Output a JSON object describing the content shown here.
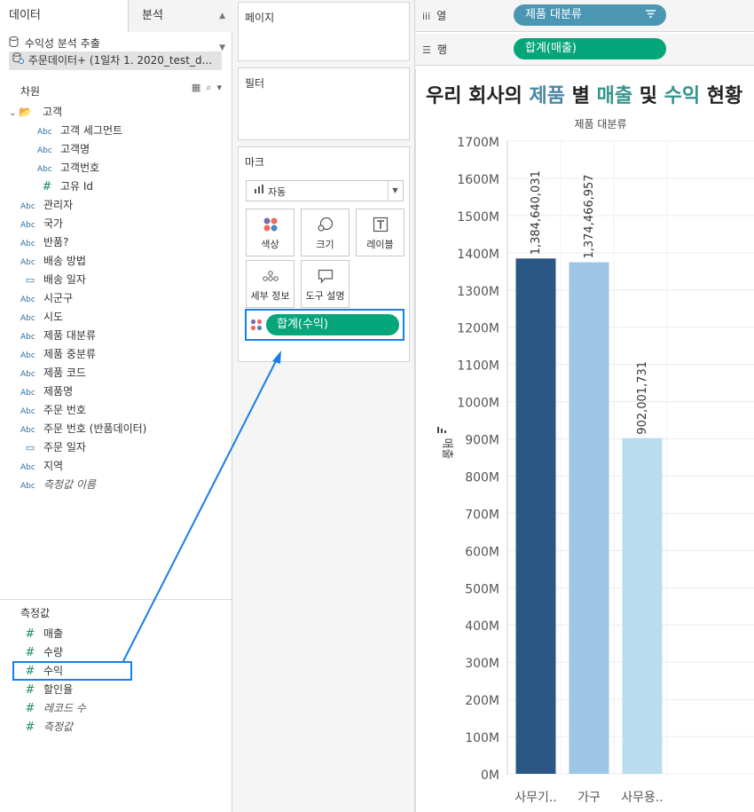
{
  "left": {
    "tabs": {
      "data": "데이터",
      "analysis": "분석"
    },
    "datasources": [
      "수익성 분석 추출",
      "주문데이터+ (1일차 1. 2020_test_d..."
    ],
    "dimensions_title": "차원",
    "dimension_fields": [
      {
        "label": "고객",
        "type": "folder",
        "indent": 0
      },
      {
        "label": "고객 세그먼트",
        "type": "abc",
        "indent": 1
      },
      {
        "label": "고객명",
        "type": "abc",
        "indent": 1
      },
      {
        "label": "고객번호",
        "type": "abc",
        "indent": 1
      },
      {
        "label": "고유 Id",
        "type": "num",
        "indent": 1
      },
      {
        "label": "관리자",
        "type": "abc",
        "indent": 0
      },
      {
        "label": "국가",
        "type": "abc",
        "indent": 0
      },
      {
        "label": "반품?",
        "type": "abc",
        "indent": 0
      },
      {
        "label": "배송 방법",
        "type": "abc",
        "indent": 0
      },
      {
        "label": "배송 일자",
        "type": "cal",
        "indent": 0
      },
      {
        "label": "시군구",
        "type": "abc",
        "indent": 0
      },
      {
        "label": "시도",
        "type": "abc",
        "indent": 0
      },
      {
        "label": "제품 대분류",
        "type": "abc",
        "indent": 0
      },
      {
        "label": "제품 중분류",
        "type": "abc",
        "indent": 0
      },
      {
        "label": "제품 코드",
        "type": "abc",
        "indent": 0
      },
      {
        "label": "제품명",
        "type": "abc",
        "indent": 0
      },
      {
        "label": "주문 번호",
        "type": "abc",
        "indent": 0
      },
      {
        "label": "주문 번호 (반품데이터)",
        "type": "abc",
        "indent": 0
      },
      {
        "label": "주문 일자",
        "type": "cal",
        "indent": 0
      },
      {
        "label": "지역",
        "type": "abc",
        "indent": 0
      },
      {
        "label": "측정값 이름",
        "type": "abc",
        "indent": 0,
        "italic": true
      }
    ],
    "measures_title": "측정값",
    "measure_fields": [
      {
        "label": "매출",
        "type": "num"
      },
      {
        "label": "수량",
        "type": "num"
      },
      {
        "label": "수익",
        "type": "num"
      },
      {
        "label": "할인율",
        "type": "num"
      },
      {
        "label": "레코드 수",
        "type": "num",
        "italic": true
      },
      {
        "label": "측정값",
        "type": "num",
        "italic": true
      }
    ]
  },
  "mid": {
    "pages_title": "페이지",
    "filters_title": "필터",
    "marks_title": "마크",
    "mark_type": "자동",
    "mark_buttons": [
      "색상",
      "크기",
      "레이블",
      "세부 정보",
      "도구 설명"
    ],
    "color_pill": "합계(수익)"
  },
  "right": {
    "columns_label": "열",
    "rows_label": "행",
    "columns_pill": "제품 대분류",
    "rows_pill": "합계(매출)",
    "title_parts": [
      "우리 회사의 ",
      "제품",
      " 별 ",
      "매출",
      " 및 ",
      "수익",
      " 현황"
    ]
  },
  "chart_data": {
    "type": "bar",
    "header": "제품 대분류",
    "ylabel": "매출",
    "categories": [
      "사무기..",
      "가구",
      "사무용.."
    ],
    "values": [
      1384640031,
      1374466957,
      902001731
    ],
    "value_labels": [
      "1,384,640,031",
      "1,374,466,957",
      "902,001,731"
    ],
    "bar_colors": [
      "#2a5783",
      "#9cc6e4",
      "#b9dcef"
    ],
    "ylim": [
      0,
      1700000000
    ],
    "yticks": [
      {
        "v": 0,
        "label": "0M"
      },
      {
        "v": 100000000,
        "label": "100M"
      },
      {
        "v": 200000000,
        "label": "200M"
      },
      {
        "v": 300000000,
        "label": "300M"
      },
      {
        "v": 400000000,
        "label": "400M"
      },
      {
        "v": 500000000,
        "label": "500M"
      },
      {
        "v": 600000000,
        "label": "600M"
      },
      {
        "v": 700000000,
        "label": "700M"
      },
      {
        "v": 800000000,
        "label": "800M"
      },
      {
        "v": 900000000,
        "label": "900M"
      },
      {
        "v": 1000000000,
        "label": "1000M"
      },
      {
        "v": 1100000000,
        "label": "1100M"
      },
      {
        "v": 1200000000,
        "label": "1200M"
      },
      {
        "v": 1300000000,
        "label": "1300M"
      },
      {
        "v": 1400000000,
        "label": "1400M"
      },
      {
        "v": 1500000000,
        "label": "1500M"
      },
      {
        "v": 1600000000,
        "label": "1600M"
      },
      {
        "v": 1700000000,
        "label": "1700M"
      }
    ],
    "gridlines": true
  },
  "colors": {
    "pill_green": "#07a57a",
    "pill_blue": "#4a96b3",
    "highlight": "#1a7ee8"
  }
}
